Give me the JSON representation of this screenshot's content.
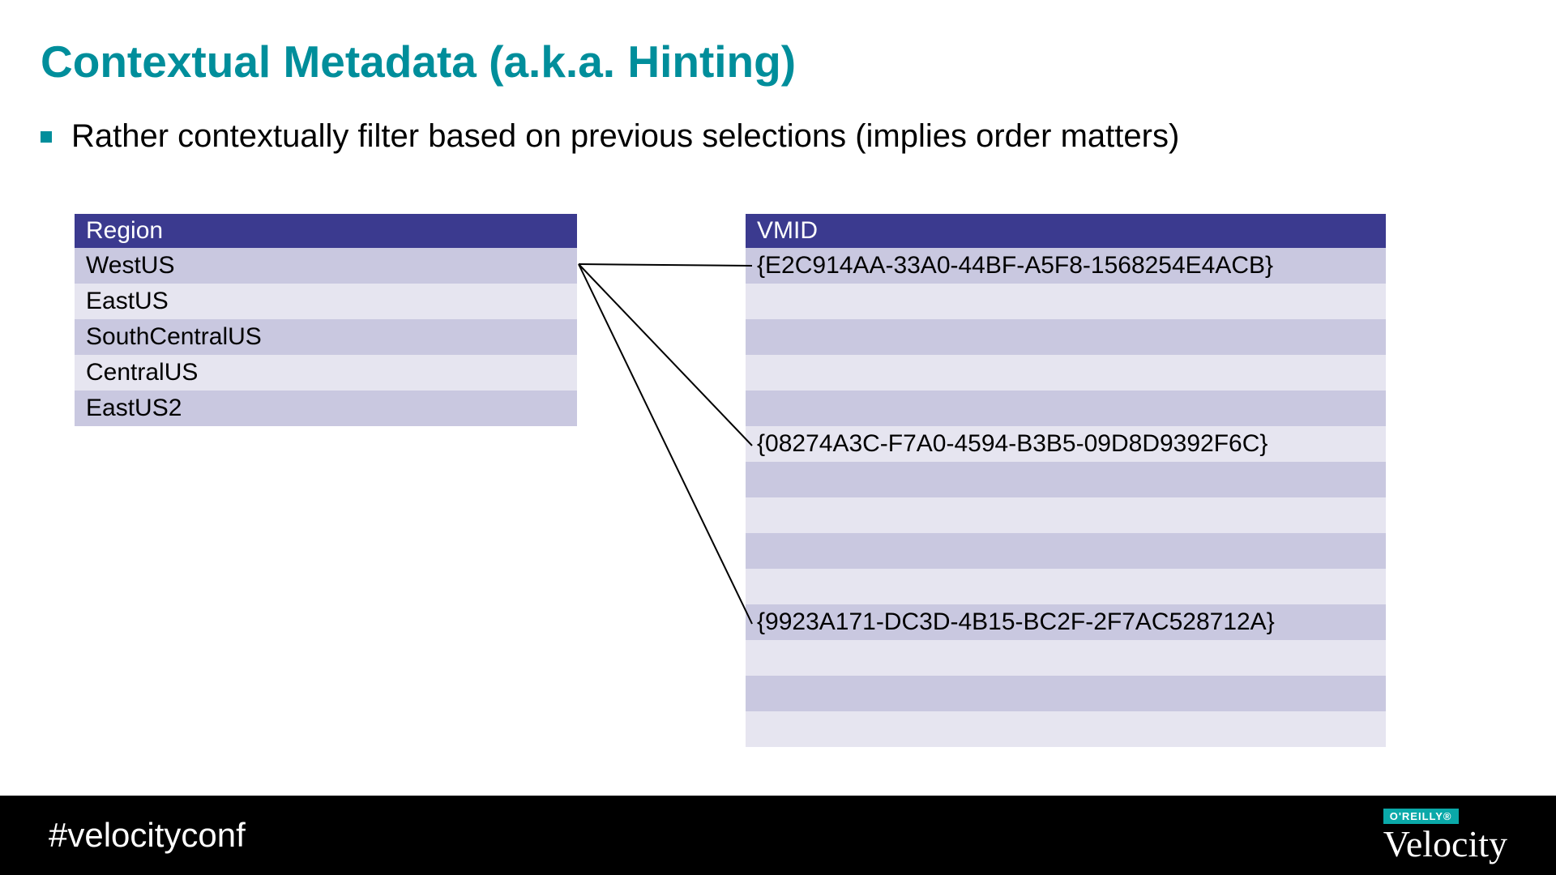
{
  "title": "Contextual Metadata (a.k.a. Hinting)",
  "bullet": "Rather contextually filter based on previous selections (implies order matters)",
  "region": {
    "header": "Region",
    "rows": [
      "WestUS",
      "EastUS",
      "SouthCentralUS",
      "CentralUS",
      "EastUS2"
    ]
  },
  "vmid": {
    "header": "VMID",
    "rows": [
      "{E2C914AA-33A0-44BF-A5F8-1568254E4ACB}",
      "",
      "",
      "",
      "",
      "{08274A3C-F7A0-4594-B3B5-09D8D9392F6C}",
      "",
      "",
      "",
      "",
      "{9923A171-DC3D-4B15-BC2F-2F7AC528712A}",
      "",
      "",
      ""
    ]
  },
  "footer": {
    "hashtag": "#velocityconf",
    "brand_top": "O'REILLY®",
    "brand_name": "Velocity"
  }
}
